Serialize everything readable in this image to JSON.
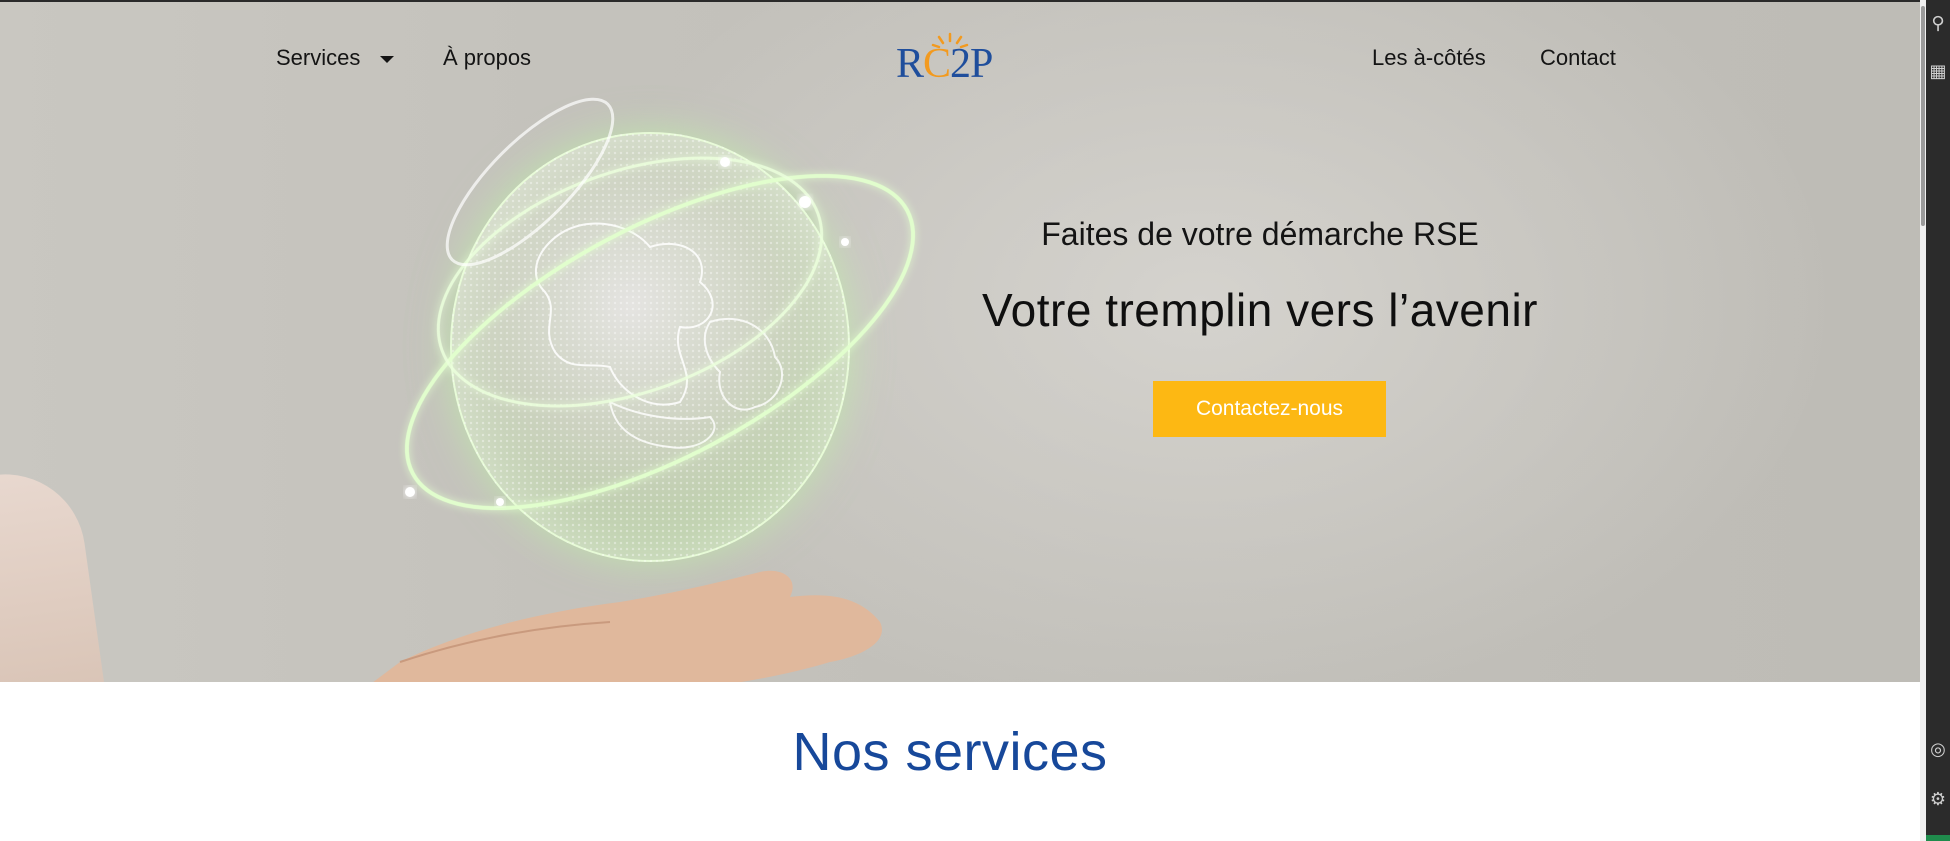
{
  "nav": {
    "services_label": "Services",
    "about_label": "À propos",
    "side_label": "Les à-côtés",
    "contact_label": "Contact"
  },
  "logo": {
    "text_r": "R",
    "text_c": "C",
    "text_2": "2",
    "text_p": "P"
  },
  "hero": {
    "subtitle": "Faites de votre démarche RSE",
    "title": "Votre tremplin vers l’avenir",
    "cta_label": "Contactez-nous"
  },
  "services": {
    "heading": "Nos services"
  },
  "colors": {
    "brand_blue": "#17489a",
    "accent_yellow": "#fdb813",
    "logo_sun_orange": "#f29a1f"
  },
  "icons": {
    "nav_caret": "chevron-down-icon",
    "logo_sun": "sun-icon"
  }
}
